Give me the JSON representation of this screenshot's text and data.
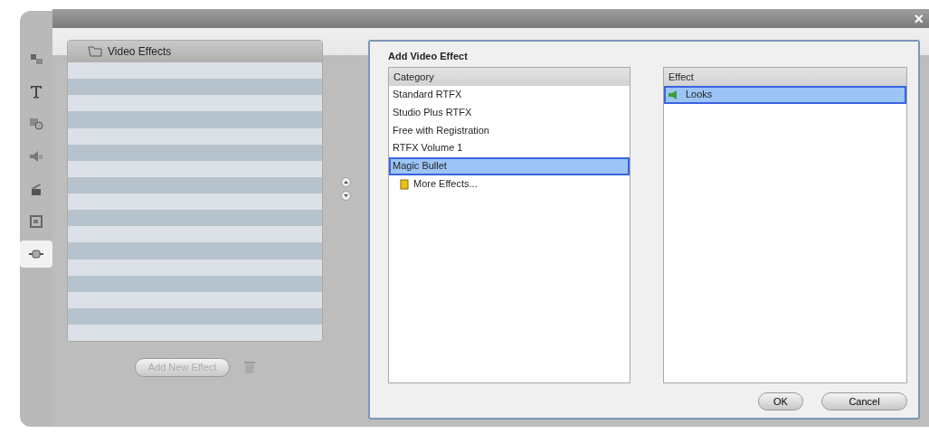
{
  "side_tabs": [
    {
      "kind": "transition",
      "selected": false
    },
    {
      "kind": "title",
      "selected": false
    },
    {
      "kind": "photo",
      "selected": false
    },
    {
      "kind": "sound",
      "selected": false
    },
    {
      "kind": "music",
      "selected": false
    },
    {
      "kind": "menu",
      "selected": false
    },
    {
      "kind": "effect",
      "selected": true
    }
  ],
  "close_button": "×",
  "effect_list": {
    "title": "Video Effects"
  },
  "add_button": {
    "label": "Add New Effect",
    "disabled": true
  },
  "dialog": {
    "title": "Add Video Effect",
    "category": {
      "header": "Category",
      "items": [
        {
          "label": "Standard RTFX",
          "selected": false,
          "kind": "plain"
        },
        {
          "label": "Studio Plus RTFX",
          "selected": false,
          "kind": "plain"
        },
        {
          "label": "Free with Registration",
          "selected": false,
          "kind": "plain"
        },
        {
          "label": "RTFX Volume 1",
          "selected": false,
          "kind": "plain"
        },
        {
          "label": "Magic Bullet",
          "selected": true,
          "kind": "plain"
        },
        {
          "label": "More Effects...",
          "selected": false,
          "kind": "more"
        }
      ]
    },
    "effect": {
      "header": "Effect",
      "items": [
        {
          "label": "Looks",
          "selected": true
        }
      ]
    },
    "buttons": [
      "OK",
      "Cancel"
    ]
  }
}
